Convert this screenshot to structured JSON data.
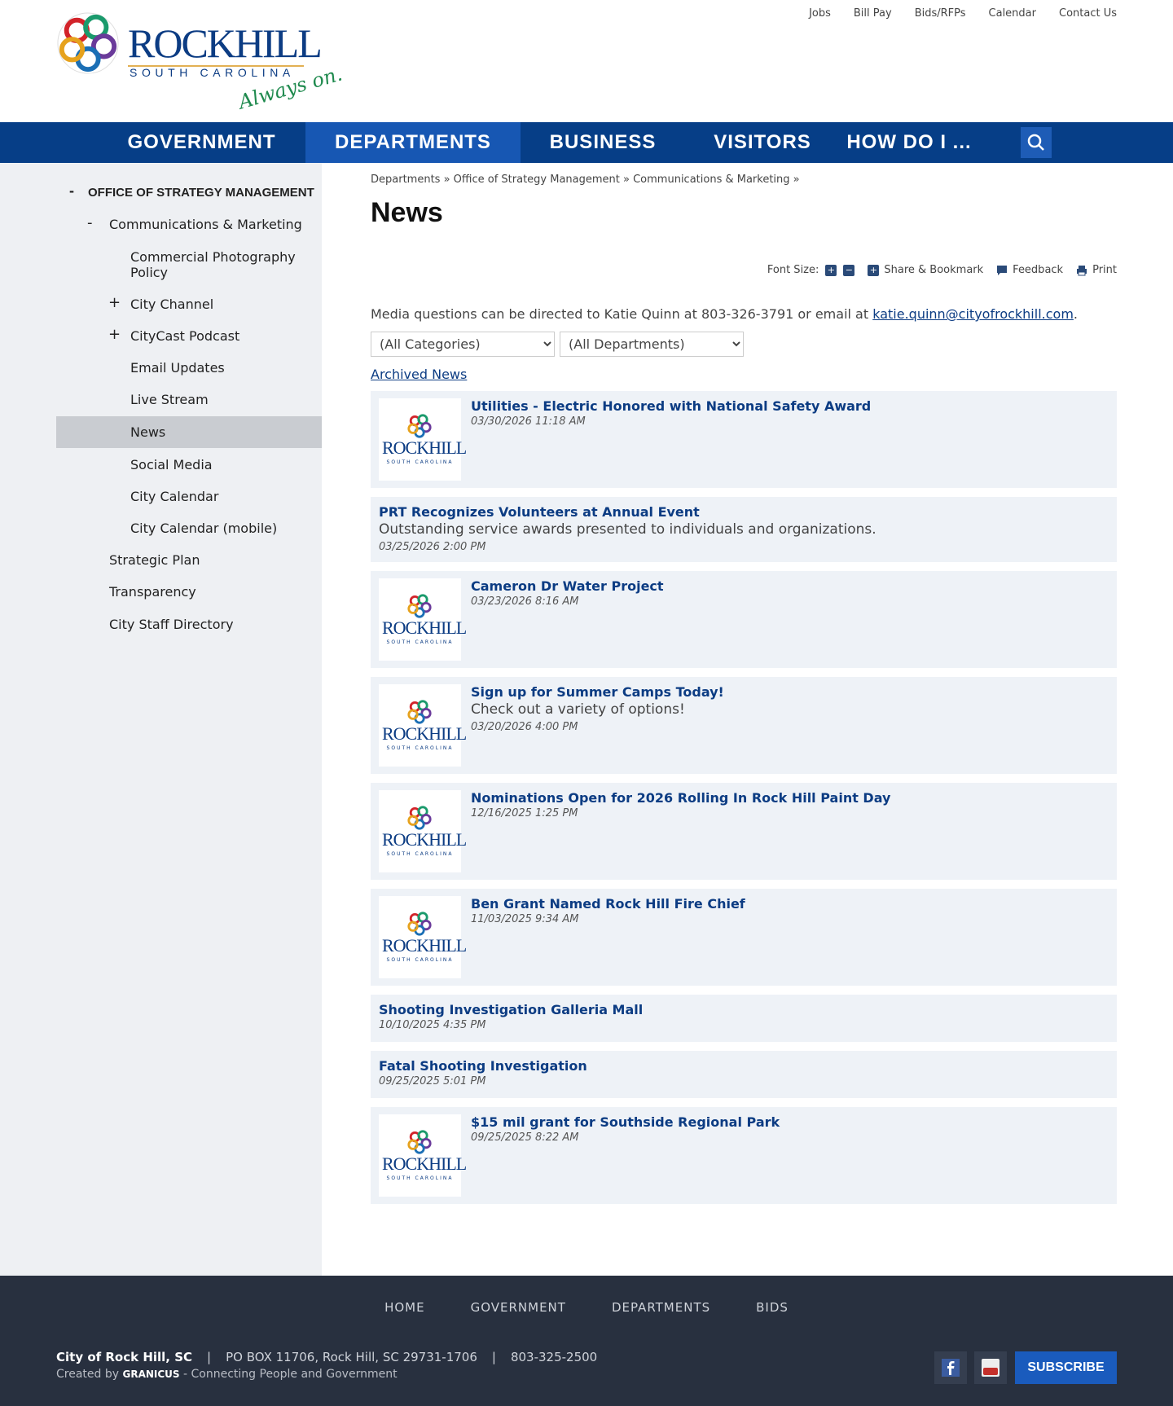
{
  "top_links": [
    "Jobs",
    "Bill Pay",
    "Bids/RFPs",
    "Calendar",
    "Contact Us"
  ],
  "logo": {
    "name": "ROCKHILL",
    "state": "SOUTH CAROLINA",
    "tagline": "Always on."
  },
  "nav": [
    "GOVERNMENT",
    "DEPARTMENTS",
    "BUSINESS",
    "VISITORS",
    "HOW DO I ..."
  ],
  "sidebar": {
    "heading": "OFFICE OF STRATEGY MANAGEMENT",
    "items": [
      "Communications & Marketing",
      "Commercial Photography Policy",
      "City Channel",
      "CityCast Podcast",
      "Email Updates",
      "Live Stream",
      "News",
      "Social Media",
      "City Calendar",
      "City Calendar (mobile)",
      "Strategic Plan",
      "Transparency",
      "City Staff Directory"
    ]
  },
  "breadcrumb": [
    "Departments",
    "Office of Strategy Management",
    "Communications & Marketing"
  ],
  "page_title": "News",
  "tools": {
    "font_size": "Font Size:",
    "share": "Share & Bookmark",
    "feedback": "Feedback",
    "print": "Print"
  },
  "media": {
    "text": "Media questions can be directed to Katie Quinn at 803-326-3791 or email at ",
    "email": "katie.quinn@cityofrockhill.com",
    "end": "."
  },
  "filters": {
    "category": "(All Categories)",
    "department": "(All Departments)"
  },
  "archived": "Archived News",
  "thumb": {
    "name": "ROCKHILL",
    "state": "SOUTH CAROLINA"
  },
  "news": [
    {
      "title": "Utilities - Electric Honored with National Safety Award",
      "date": "03/30/2026 11:18 AM"
    },
    {
      "title": "PRT Recognizes Volunteers at Annual Event",
      "desc": "Outstanding service awards presented to individuals and organizations.",
      "date": "03/25/2026 2:00 PM"
    },
    {
      "title": "Cameron Dr Water Project",
      "date": "03/23/2026 8:16 AM"
    },
    {
      "title": "Sign up for Summer Camps Today!",
      "desc": "Check out a variety of options!",
      "date": "03/20/2026 4:00 PM"
    },
    {
      "title": "Nominations Open for 2026 Rolling In Rock Hill Paint Day",
      "date": "12/16/2025 1:25 PM"
    },
    {
      "title": "Ben Grant Named Rock Hill Fire Chief",
      "date": "11/03/2025 9:34 AM"
    },
    {
      "title": "Shooting Investigation Galleria Mall",
      "date": "10/10/2025 4:35 PM"
    },
    {
      "title": "Fatal Shooting Investigation",
      "date": "09/25/2025 5:01 PM"
    },
    {
      "title": "$15 mil grant for Southside Regional Park",
      "date": "09/25/2025 8:22 AM"
    }
  ],
  "footer": {
    "nav": [
      "HOME",
      "GOVERNMENT",
      "DEPARTMENTS",
      "BIDS"
    ],
    "city": "City of Rock Hill, SC",
    "address": "PO BOX 11706, Rock Hill, SC 29731-1706",
    "phone": "803-325-2500",
    "created": "Created by ",
    "granicus": "GRANICUS",
    "tag": " - Connecting People and Government",
    "subscribe": "SUBSCRIBE"
  }
}
